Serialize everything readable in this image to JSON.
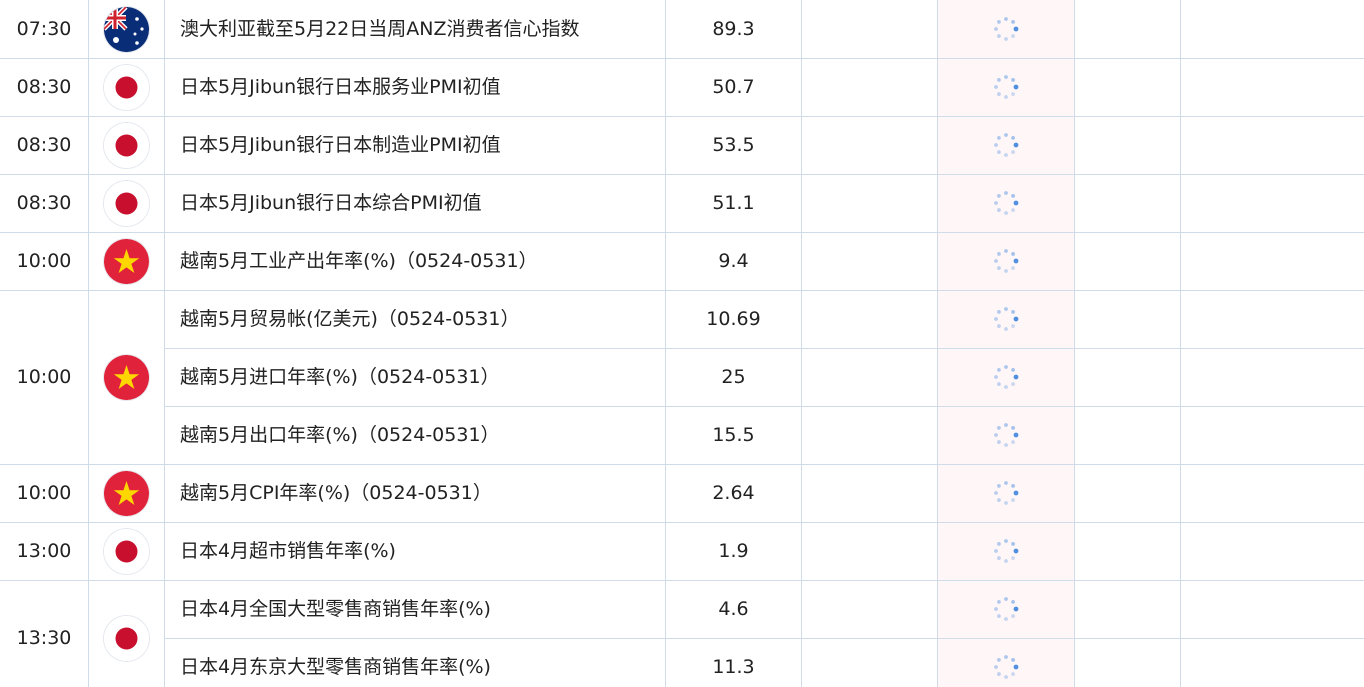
{
  "colors": {
    "grid_line": "#cfdbe9",
    "pending_column": "#fff6f7",
    "spinner": "#4f90e0"
  },
  "groups": [
    {
      "time": "07:30",
      "country_icon": "australia-flag-icon",
      "events": [
        {
          "title": "澳大利亚截至5月22日当周ANZ消费者信心指数",
          "previous": "89.3"
        }
      ]
    },
    {
      "time": "08:30",
      "country_icon": "japan-flag-icon",
      "events": [
        {
          "title": "日本5月Jibun银行日本服务业PMI初值",
          "previous": "50.7"
        }
      ]
    },
    {
      "time": "08:30",
      "country_icon": "japan-flag-icon",
      "events": [
        {
          "title": "日本5月Jibun银行日本制造业PMI初值",
          "previous": "53.5"
        }
      ]
    },
    {
      "time": "08:30",
      "country_icon": "japan-flag-icon",
      "events": [
        {
          "title": "日本5月Jibun银行日本综合PMI初值",
          "previous": "51.1"
        }
      ]
    },
    {
      "time": "10:00",
      "country_icon": "vietnam-flag-icon",
      "events": [
        {
          "title": "越南5月工业产出年率(%)（0524-0531）",
          "previous": "9.4"
        }
      ]
    },
    {
      "time": "10:00",
      "country_icon": "vietnam-flag-icon",
      "events": [
        {
          "title": "越南5月贸易帐(亿美元)（0524-0531）",
          "previous": "10.69"
        },
        {
          "title": "越南5月进口年率(%)（0524-0531）",
          "previous": "25"
        },
        {
          "title": "越南5月出口年率(%)（0524-0531）",
          "previous": "15.5"
        }
      ]
    },
    {
      "time": "10:00",
      "country_icon": "vietnam-flag-icon",
      "events": [
        {
          "title": "越南5月CPI年率(%)（0524-0531）",
          "previous": "2.64"
        }
      ]
    },
    {
      "time": "13:00",
      "country_icon": "japan-flag-icon",
      "events": [
        {
          "title": "日本4月超市销售年率(%)",
          "previous": "1.9"
        }
      ]
    },
    {
      "time": "13:30",
      "country_icon": "japan-flag-icon",
      "events": [
        {
          "title": "日本4月全国大型零售商销售年率(%)",
          "previous": "4.6"
        },
        {
          "title": "日本4月东京大型零售商销售年率(%)",
          "previous": "11.3"
        }
      ]
    }
  ]
}
